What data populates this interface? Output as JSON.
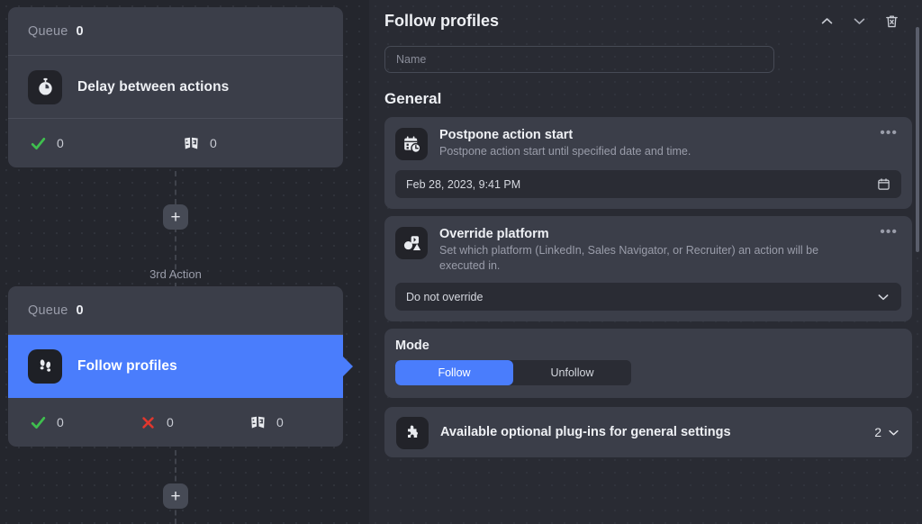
{
  "canvas": {
    "cards": [
      {
        "queue_label": "Queue",
        "queue_count": "0",
        "title": "Follow profiles",
        "icon": "stopwatch-icon",
        "selected": false,
        "stats": [
          {
            "icon": "check-icon",
            "value": "0"
          },
          {
            "icon": "theater-masks-icon",
            "value": "0"
          }
        ]
      },
      {
        "queue_label": "Queue",
        "queue_count": "0",
        "title": "Follow profiles",
        "icon": "footprints-icon",
        "selected": true,
        "stats": [
          {
            "icon": "check-icon",
            "value": "0"
          },
          {
            "icon": "cross-icon",
            "value": "0"
          },
          {
            "icon": "theater-masks-icon",
            "value": "0"
          }
        ]
      }
    ],
    "card_1_title": "Delay between actions",
    "card_2_title": "Follow profiles",
    "connector_label": "3rd Action",
    "add_button_label": "+"
  },
  "panel": {
    "title": "Follow profiles",
    "header_icons": [
      {
        "name": "chevron-up-icon"
      },
      {
        "name": "chevron-down-icon"
      },
      {
        "name": "trash-icon"
      }
    ],
    "name_field": {
      "placeholder": "Name",
      "value": ""
    },
    "general_heading": "General",
    "options": [
      {
        "icon": "calendar-clock-icon",
        "title": "Postpone action start",
        "description": "Postpone action start until specified date and time.",
        "menu_label": "•••",
        "field_value": "Feb 28, 2023, 9:41 PM",
        "field_icon": "calendar-icon"
      },
      {
        "icon": "override-platform-icon",
        "title": "Override platform",
        "description": "Set which platform (LinkedIn, Sales Navigator, or Recruiter) an action will be executed in.",
        "menu_label": "•••",
        "field_value": "Do not override",
        "field_icon": "chevron-down-icon"
      }
    ],
    "mode": {
      "label": "Mode",
      "options": [
        "Follow",
        "Unfollow"
      ],
      "selected": "Follow"
    },
    "plugins": {
      "icon": "puzzle-piece-icon",
      "title": "Available optional plug-ins for general settings",
      "count": "2",
      "chevron": "chevron-down-icon"
    }
  },
  "colors": {
    "accent_blue": "#4a7dfc",
    "card_bg": "#3b3e49",
    "canvas_bg": "#24262d",
    "panel_bg": "#292b33",
    "success_green": "#3fbf4e",
    "error_red": "#e0372e"
  }
}
